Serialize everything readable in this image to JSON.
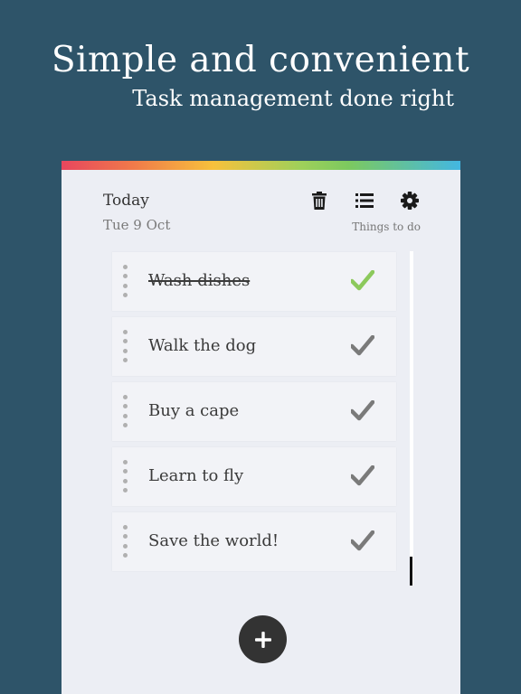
{
  "promo": {
    "headline": "Simple and convenient",
    "subheadline": "Task management done right"
  },
  "header": {
    "title": "Today",
    "date": "Tue 9 Oct",
    "list_label": "Things to do"
  },
  "toolbar": {
    "icons": [
      "trash-icon",
      "list-icon",
      "gear-icon"
    ]
  },
  "tasks": [
    {
      "label": "Wash dishes",
      "done": true
    },
    {
      "label": "Walk the dog",
      "done": false
    },
    {
      "label": "Buy a cape",
      "done": false
    },
    {
      "label": "Learn to fly",
      "done": false
    },
    {
      "label": "Save the world!",
      "done": false
    }
  ],
  "colors": {
    "background": "#2e5469",
    "card": "#eceef4",
    "check_done": "#8cc95c",
    "check_pending": "#7a7a7a",
    "fab": "#333333"
  },
  "fab": {
    "icon": "plus-icon"
  }
}
